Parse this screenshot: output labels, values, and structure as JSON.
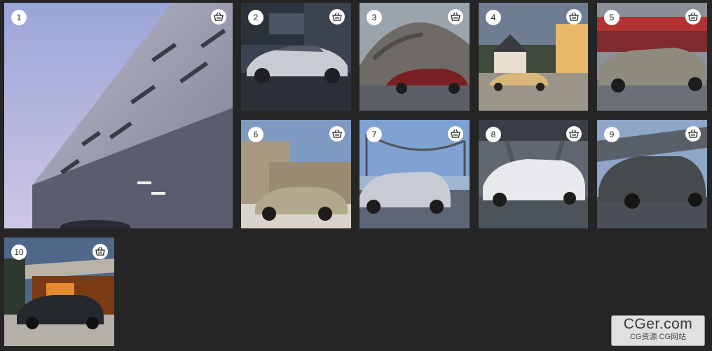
{
  "gallery": {
    "items": [
      {
        "number": "1",
        "cart_icon": "basket-icon"
      },
      {
        "number": "2",
        "cart_icon": "basket-icon"
      },
      {
        "number": "3",
        "cart_icon": "basket-icon"
      },
      {
        "number": "4",
        "cart_icon": "basket-icon"
      },
      {
        "number": "5",
        "cart_icon": "basket-icon"
      },
      {
        "number": "6",
        "cart_icon": "basket-icon"
      },
      {
        "number": "7",
        "cart_icon": "basket-icon"
      },
      {
        "number": "8",
        "cart_icon": "basket-icon"
      },
      {
        "number": "9",
        "cart_icon": "basket-icon"
      },
      {
        "number": "10",
        "cart_icon": "basket-icon"
      }
    ]
  },
  "watermark": {
    "title": "CGer.com",
    "subtitle": "CG资源 CG网站"
  },
  "colors": {
    "background": "#252525",
    "badge": "#ffffff"
  }
}
